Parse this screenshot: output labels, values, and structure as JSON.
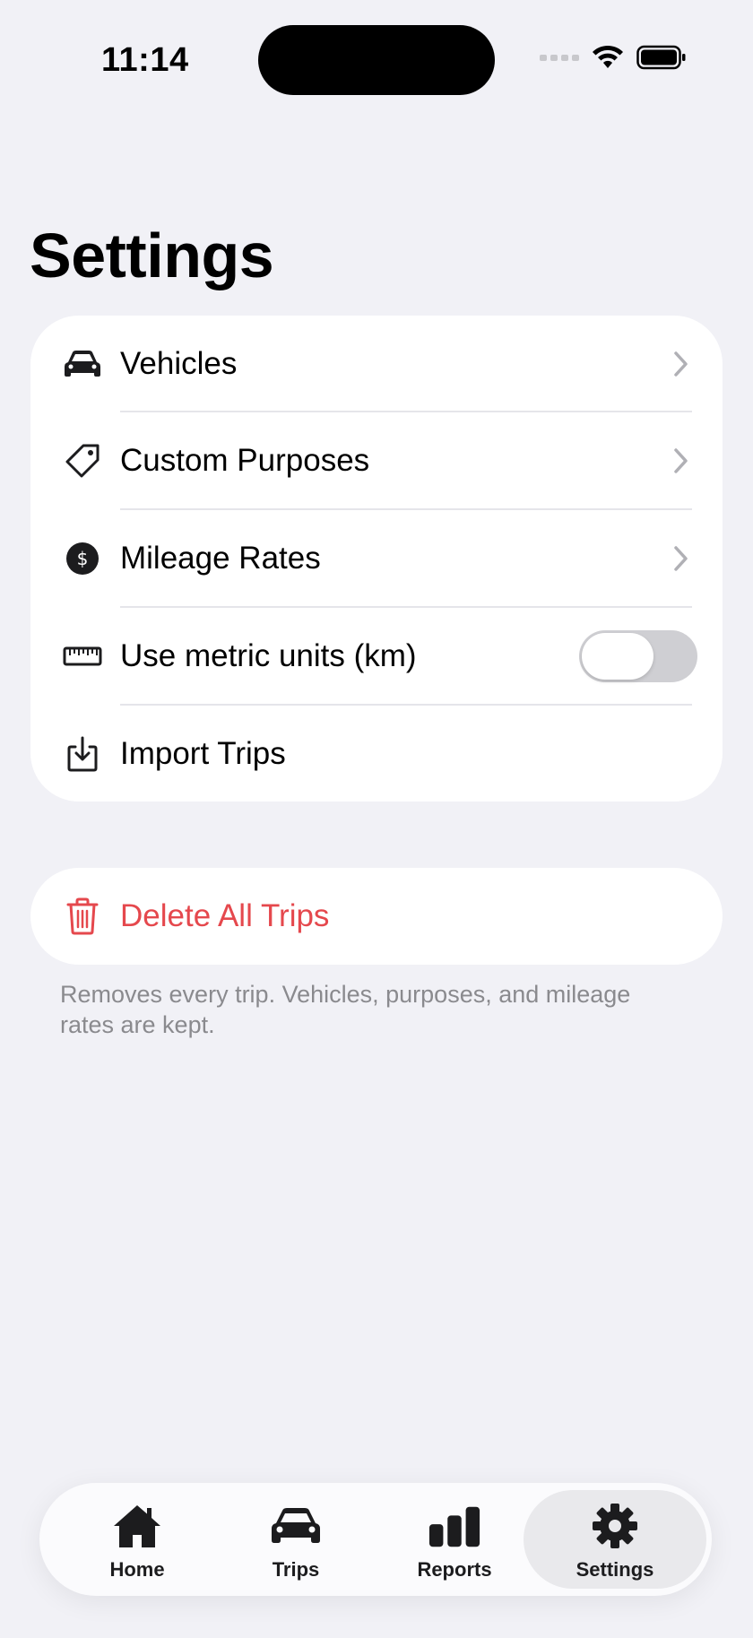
{
  "status_bar": {
    "time": "11:14"
  },
  "page": {
    "title": "Settings"
  },
  "settings": {
    "items": [
      {
        "label": "Vehicles",
        "icon": "car-icon"
      },
      {
        "label": "Custom Purposes",
        "icon": "tag-icon"
      },
      {
        "label": "Mileage Rates",
        "icon": "dollar-circle-icon"
      },
      {
        "label": "Use metric units (km)",
        "icon": "ruler-icon",
        "toggle_on": false
      },
      {
        "label": "Import Trips",
        "icon": "import-icon"
      }
    ]
  },
  "danger": {
    "delete_label": "Delete All Trips",
    "footnote": "Removes every trip. Vehicles, purposes, and mileage rates are kept."
  },
  "tabbar": {
    "tabs": [
      {
        "label": "Home",
        "icon": "house-icon"
      },
      {
        "label": "Trips",
        "icon": "car-icon"
      },
      {
        "label": "Reports",
        "icon": "bar-chart-icon"
      },
      {
        "label": "Settings",
        "icon": "gear-icon",
        "active": true
      }
    ]
  },
  "colors": {
    "destructive": "#e5484d",
    "background": "#f1f1f6",
    "toggle_off": "#cfcfd3"
  }
}
